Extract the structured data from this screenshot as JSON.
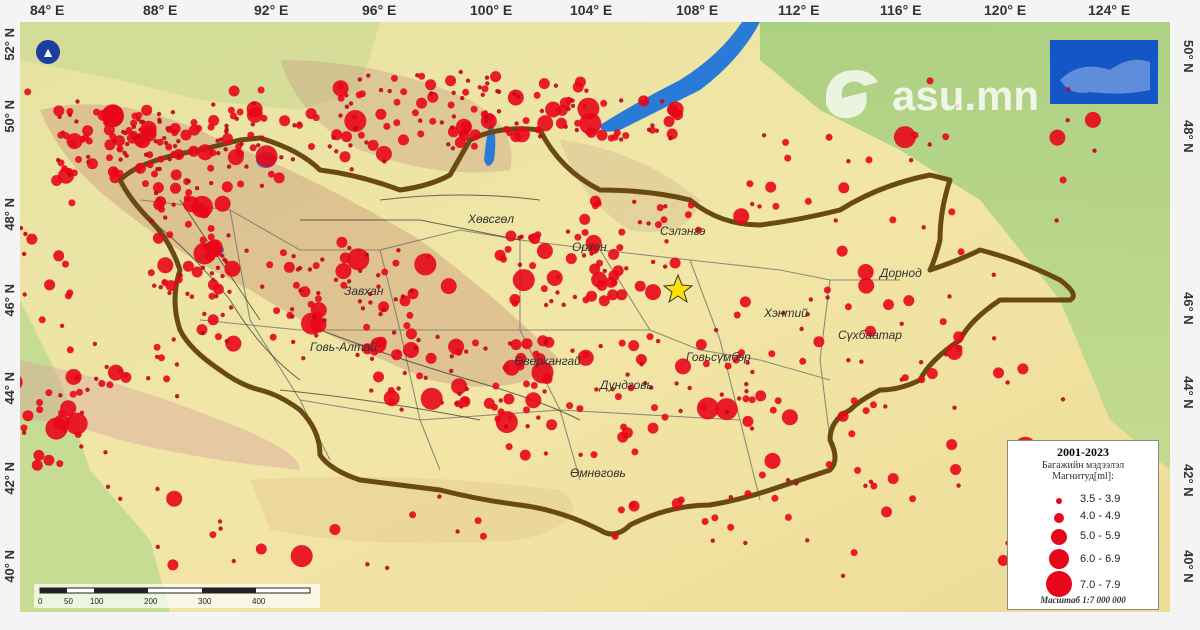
{
  "map": {
    "lon_labels": [
      "84° E",
      "88° E",
      "92° E",
      "96° E",
      "100° E",
      "104° E",
      "108° E",
      "112° E",
      "116° E",
      "120° E",
      "124° E"
    ],
    "lat_labels_left": [
      "52° N",
      "50° N",
      "48° N",
      "46° N",
      "44° N",
      "42° N",
      "40° N"
    ],
    "lat_labels_right": [
      "50° N",
      "48° N",
      "46° N",
      "44° N",
      "42° N",
      "40° N"
    ],
    "place_labels": [
      "Хөвсгөл",
      "Орхон",
      "Сэлэнгэ",
      "Завхан",
      "Говь-Алтай",
      "Өвөрхангай",
      "Говьсүмбэр",
      "Дундговь",
      "Өмнөговь",
      "Хэнтий",
      "Сүхбаатар",
      "Дорнод"
    ],
    "north_symbol": "north-arrow-icon",
    "colors": {
      "quake": "#e8071a",
      "border": "#6a4a12",
      "water": "#2a7bd8",
      "land": "#f2e6a6",
      "relief": "#b5826a"
    }
  },
  "watermark": {
    "text": "asu.mn"
  },
  "legend": {
    "title": "2001-2023",
    "subtitle": "Багажийн мэдээлэл",
    "mag_label": "Магнитуд[ml]:",
    "classes": [
      "3.5 - 3.9",
      "4.0 - 4.9",
      "5.0 - 5.9",
      "6.0 - 6.9",
      "7.0 - 7.9"
    ],
    "scale": "Масштаб 1:7 000 000"
  },
  "scalebar": {
    "ticks": [
      "0",
      "50",
      "100",
      "200",
      "300",
      "400"
    ]
  }
}
